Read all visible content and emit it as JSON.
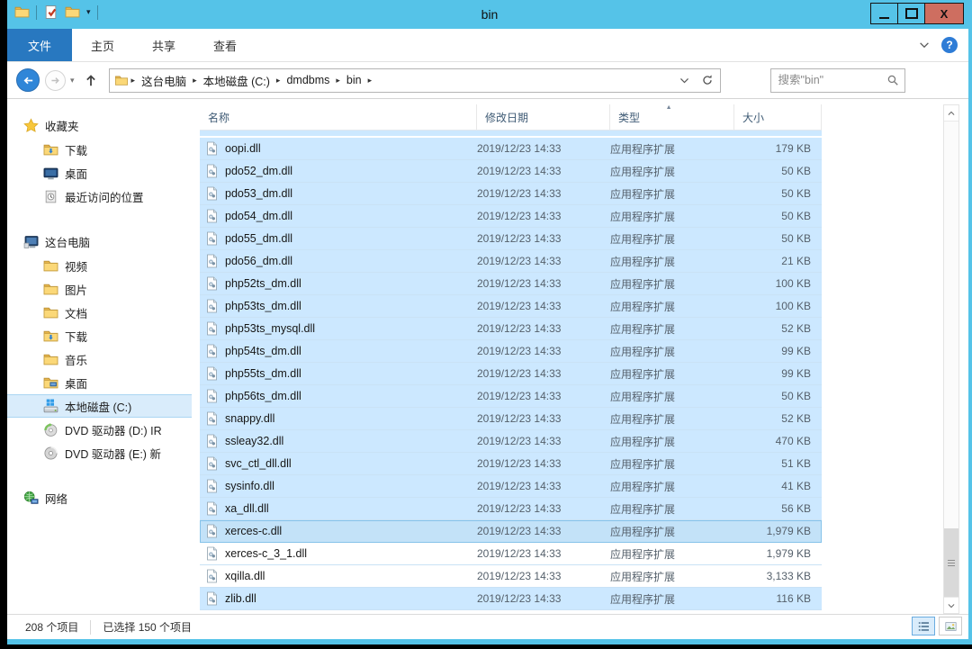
{
  "colors": {
    "frame": "#55c3e8",
    "active_tab": "#2878c0",
    "close_button": "#ce6e60",
    "selection": "#cce8ff",
    "help_icon": "#2e7cd6"
  },
  "titlebar": {
    "title": "bin"
  },
  "ribbon": {
    "tabs": [
      {
        "label": "文件",
        "active": true
      },
      {
        "label": "主页",
        "active": false
      },
      {
        "label": "共享",
        "active": false
      },
      {
        "label": "查看",
        "active": false
      }
    ]
  },
  "address": {
    "breadcrumb": [
      "这台电脑",
      "本地磁盘 (C:)",
      "dmdbms",
      "bin"
    ],
    "search_placeholder": "搜索\"bin\""
  },
  "sidebar": {
    "sections": [
      {
        "label": "收藏夹",
        "icon": "star-icon",
        "items": [
          {
            "label": "下载",
            "icon": "folder-download-icon"
          },
          {
            "label": "桌面",
            "icon": "desktop-icon"
          },
          {
            "label": "最近访问的位置",
            "icon": "recent-places-icon"
          }
        ]
      },
      {
        "label": "这台电脑",
        "icon": "computer-icon",
        "items": [
          {
            "label": "视频",
            "icon": "folder-icon"
          },
          {
            "label": "图片",
            "icon": "folder-icon"
          },
          {
            "label": "文档",
            "icon": "folder-icon"
          },
          {
            "label": "下载",
            "icon": "folder-download-icon"
          },
          {
            "label": "音乐",
            "icon": "folder-icon"
          },
          {
            "label": "桌面",
            "icon": "folder-desktop-icon"
          },
          {
            "label": "本地磁盘 (C:)",
            "icon": "disk-icon",
            "selected": true
          },
          {
            "label": "DVD 驱动器 (D:) IR",
            "icon": "dvd-green-icon"
          },
          {
            "label": "DVD 驱动器 (E:) 新",
            "icon": "dvd-gray-icon"
          }
        ]
      },
      {
        "label": "网络",
        "icon": "network-icon",
        "items": []
      }
    ]
  },
  "list": {
    "columns": [
      {
        "label": "名称",
        "sorted": false
      },
      {
        "label": "修改日期",
        "sorted": false
      },
      {
        "label": "类型",
        "sorted": true
      },
      {
        "label": "大小",
        "sorted": false
      }
    ],
    "rows": [
      {
        "name": "oopi.dll",
        "date": "2019/12/23 14:33",
        "type": "应用程序扩展",
        "size": "179 KB",
        "selected": true
      },
      {
        "name": "pdo52_dm.dll",
        "date": "2019/12/23 14:33",
        "type": "应用程序扩展",
        "size": "50 KB",
        "selected": true
      },
      {
        "name": "pdo53_dm.dll",
        "date": "2019/12/23 14:33",
        "type": "应用程序扩展",
        "size": "50 KB",
        "selected": true
      },
      {
        "name": "pdo54_dm.dll",
        "date": "2019/12/23 14:33",
        "type": "应用程序扩展",
        "size": "50 KB",
        "selected": true
      },
      {
        "name": "pdo55_dm.dll",
        "date": "2019/12/23 14:33",
        "type": "应用程序扩展",
        "size": "50 KB",
        "selected": true
      },
      {
        "name": "pdo56_dm.dll",
        "date": "2019/12/23 14:33",
        "type": "应用程序扩展",
        "size": "21 KB",
        "selected": true
      },
      {
        "name": "php52ts_dm.dll",
        "date": "2019/12/23 14:33",
        "type": "应用程序扩展",
        "size": "100 KB",
        "selected": true
      },
      {
        "name": "php53ts_dm.dll",
        "date": "2019/12/23 14:33",
        "type": "应用程序扩展",
        "size": "100 KB",
        "selected": true
      },
      {
        "name": "php53ts_mysql.dll",
        "date": "2019/12/23 14:33",
        "type": "应用程序扩展",
        "size": "52 KB",
        "selected": true
      },
      {
        "name": "php54ts_dm.dll",
        "date": "2019/12/23 14:33",
        "type": "应用程序扩展",
        "size": "99 KB",
        "selected": true
      },
      {
        "name": "php55ts_dm.dll",
        "date": "2019/12/23 14:33",
        "type": "应用程序扩展",
        "size": "99 KB",
        "selected": true
      },
      {
        "name": "php56ts_dm.dll",
        "date": "2019/12/23 14:33",
        "type": "应用程序扩展",
        "size": "50 KB",
        "selected": true
      },
      {
        "name": "snappy.dll",
        "date": "2019/12/23 14:33",
        "type": "应用程序扩展",
        "size": "52 KB",
        "selected": true
      },
      {
        "name": "ssleay32.dll",
        "date": "2019/12/23 14:33",
        "type": "应用程序扩展",
        "size": "470 KB",
        "selected": true
      },
      {
        "name": "svc_ctl_dll.dll",
        "date": "2019/12/23 14:33",
        "type": "应用程序扩展",
        "size": "51 KB",
        "selected": true
      },
      {
        "name": "sysinfo.dll",
        "date": "2019/12/23 14:33",
        "type": "应用程序扩展",
        "size": "41 KB",
        "selected": true
      },
      {
        "name": "xa_dll.dll",
        "date": "2019/12/23 14:33",
        "type": "应用程序扩展",
        "size": "56 KB",
        "selected": true
      },
      {
        "name": "xerces-c.dll",
        "date": "2019/12/23 14:33",
        "type": "应用程序扩展",
        "size": "1,979 KB",
        "selected": true,
        "focused": true
      },
      {
        "name": "xerces-c_3_1.dll",
        "date": "2019/12/23 14:33",
        "type": "应用程序扩展",
        "size": "1,979 KB",
        "selected": false
      },
      {
        "name": "xqilla.dll",
        "date": "2019/12/23 14:33",
        "type": "应用程序扩展",
        "size": "3,133 KB",
        "selected": false
      },
      {
        "name": "zlib.dll",
        "date": "2019/12/23 14:33",
        "type": "应用程序扩展",
        "size": "116 KB",
        "selected": true
      }
    ]
  },
  "status": {
    "items_count": "208 个项目",
    "selection_count": "已选择 150 个项目"
  }
}
